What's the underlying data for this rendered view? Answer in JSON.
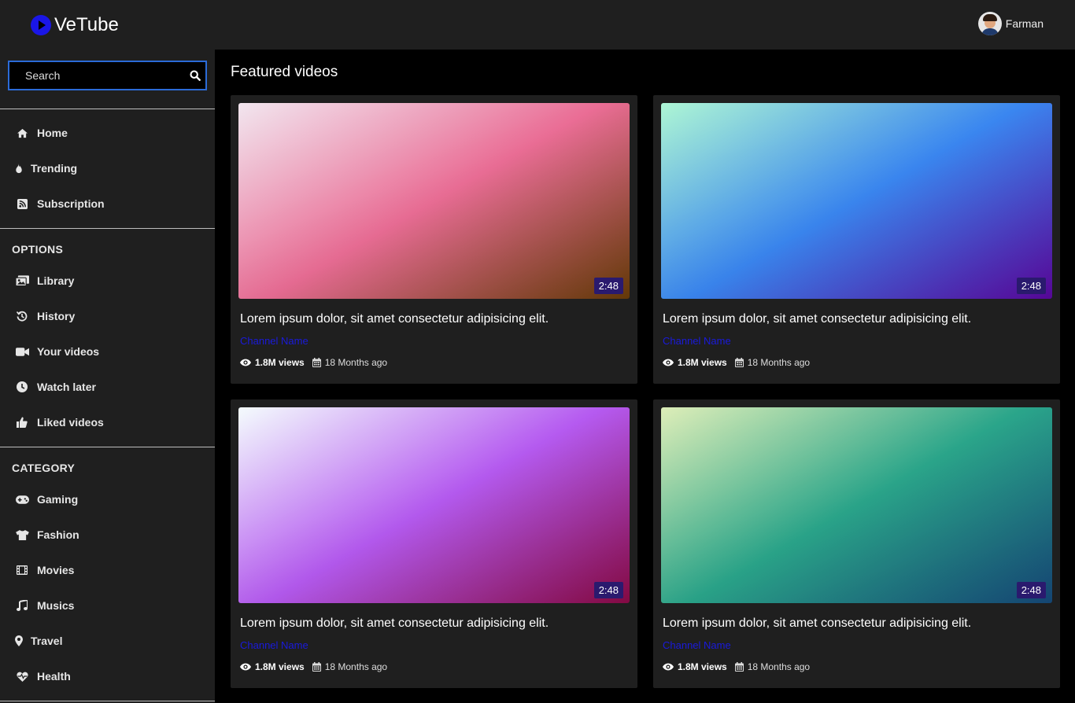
{
  "app": {
    "name": "VeTube"
  },
  "user": {
    "name": "Farman"
  },
  "search": {
    "placeholder": "Search"
  },
  "nav": {
    "main": [
      {
        "label": "Home",
        "icon": "home-icon"
      },
      {
        "label": "Trending",
        "icon": "fire-icon"
      },
      {
        "label": "Subscription",
        "icon": "rss-icon"
      }
    ],
    "options_title": "OPTIONS",
    "options": [
      {
        "label": "Library",
        "icon": "library-icon"
      },
      {
        "label": "History",
        "icon": "history-icon"
      },
      {
        "label": "Your videos",
        "icon": "video-camera-icon"
      },
      {
        "label": "Watch later",
        "icon": "clock-icon"
      },
      {
        "label": "Liked videos",
        "icon": "thumbs-up-icon"
      }
    ],
    "category_title": "CATEGORY",
    "categories": [
      {
        "label": "Gaming",
        "icon": "gamepad-icon"
      },
      {
        "label": "Fashion",
        "icon": "tshirt-icon"
      },
      {
        "label": "Movies",
        "icon": "film-icon"
      },
      {
        "label": "Musics",
        "icon": "music-icon"
      },
      {
        "label": "Travel",
        "icon": "map-marker-icon"
      },
      {
        "label": "Health",
        "icon": "heartbeat-icon"
      }
    ]
  },
  "main": {
    "title": "Featured videos",
    "videos": [
      {
        "title": "Lorem ipsum dolor, sit amet consectetur adipisicing elit.",
        "channel": "Channel Name",
        "views": "1.8M views",
        "date": "18 Months ago",
        "duration": "2:48",
        "colors": [
          "#f1e4ee",
          "#ea6d95",
          "#6b3d08"
        ]
      },
      {
        "title": "Lorem ipsum dolor, sit amet consectetur adipisicing elit.",
        "channel": "Channel Name",
        "views": "1.8M views",
        "date": "18 Months ago",
        "duration": "2:48",
        "colors": [
          "#a8f5d2",
          "#3a86f0",
          "#5d07a3"
        ]
      },
      {
        "title": "Lorem ipsum dolor, sit amet consectetur adipisicing elit.",
        "channel": "Channel Name",
        "views": "1.8M views",
        "date": "18 Months ago",
        "duration": "2:48",
        "colors": [
          "#f3fbfd",
          "#b55af0",
          "#8e0a48"
        ]
      },
      {
        "title": "Lorem ipsum dolor, sit amet consectetur adipisicing elit.",
        "channel": "Channel Name",
        "views": "1.8M views",
        "date": "18 Months ago",
        "duration": "2:48",
        "colors": [
          "#dbedb4",
          "#2aa58a",
          "#164b7c"
        ]
      }
    ]
  }
}
